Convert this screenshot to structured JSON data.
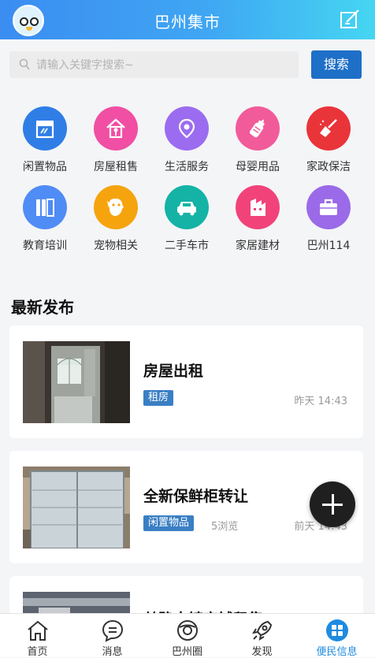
{
  "header": {
    "title": "巴州集市"
  },
  "search": {
    "placeholder": "请输入关键字搜索~",
    "button_label": "搜索"
  },
  "categories": [
    {
      "label": "闲置物品",
      "icon": "shop-icon",
      "color": "#2f7ee6"
    },
    {
      "label": "房屋租售",
      "icon": "house-icon",
      "color": "#f04fa3"
    },
    {
      "label": "生活服务",
      "icon": "location-pin-icon",
      "color": "#9b6cf0"
    },
    {
      "label": "母婴用品",
      "icon": "baby-bottle-icon",
      "color": "#f25b9a"
    },
    {
      "label": "家政保洁",
      "icon": "broom-icon",
      "color": "#e9343a"
    },
    {
      "label": "教育培训",
      "icon": "books-icon",
      "color": "#4f8cf5"
    },
    {
      "label": "宠物相关",
      "icon": "dog-icon",
      "color": "#f5a40e"
    },
    {
      "label": "二手车市",
      "icon": "car-icon",
      "color": "#14b3a6"
    },
    {
      "label": "家居建材",
      "icon": "building-materials-icon",
      "color": "#f1437a"
    },
    {
      "label": "巴州114",
      "icon": "briefcase-icon",
      "color": "#9a6ae8"
    }
  ],
  "latest": {
    "title": "最新发布",
    "items": [
      {
        "title": "房屋出租",
        "tag": "租房",
        "views": "",
        "time": "昨天 14:43"
      },
      {
        "title": "全新保鲜柜转让",
        "tag": "闲置物品",
        "views": "5浏览",
        "time": "前天 14:43"
      },
      {
        "title": "丝路大镇商铺租售",
        "tag": "",
        "views": "",
        "time": ""
      }
    ]
  },
  "nav": [
    {
      "label": "首页",
      "icon": "home-icon",
      "active": false
    },
    {
      "label": "消息",
      "icon": "message-icon",
      "active": false
    },
    {
      "label": "巴州圈",
      "icon": "circle-icon",
      "active": false
    },
    {
      "label": "发现",
      "icon": "rocket-icon",
      "active": false
    },
    {
      "label": "便民信息",
      "icon": "grid-icon",
      "active": true
    }
  ],
  "colors": {
    "accent": "#1e8be0",
    "search_button": "#1e6fc7",
    "tag": "#3a7fc4"
  }
}
